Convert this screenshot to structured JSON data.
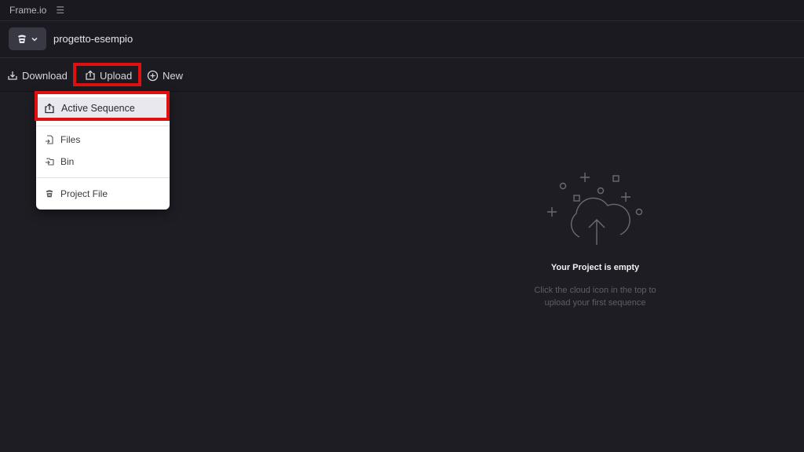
{
  "app": {
    "title": "Frame.io",
    "menu_icon": "hamburger-icon"
  },
  "project": {
    "name": "progetto-esempio",
    "switch_icon": "frameio-logo-icon"
  },
  "toolbar": {
    "download_label": "Download",
    "upload_label": "Upload",
    "new_label": "New"
  },
  "upload_menu": {
    "items": [
      {
        "label": "Active Sequence",
        "icon": "upload-icon"
      },
      {
        "label": "Files",
        "icon": "file-upload-icon"
      },
      {
        "label": "Bin",
        "icon": "folder-upload-icon"
      },
      {
        "label": "Project File",
        "icon": "frameio-logo-icon"
      }
    ]
  },
  "empty_state": {
    "title": "Your Project is empty",
    "line1": "Click the cloud icon in the top to",
    "line2": "upload your first sequence"
  },
  "colors": {
    "background": "#1e1d24",
    "menu_background": "#ffffff",
    "highlight": "#e11010"
  }
}
